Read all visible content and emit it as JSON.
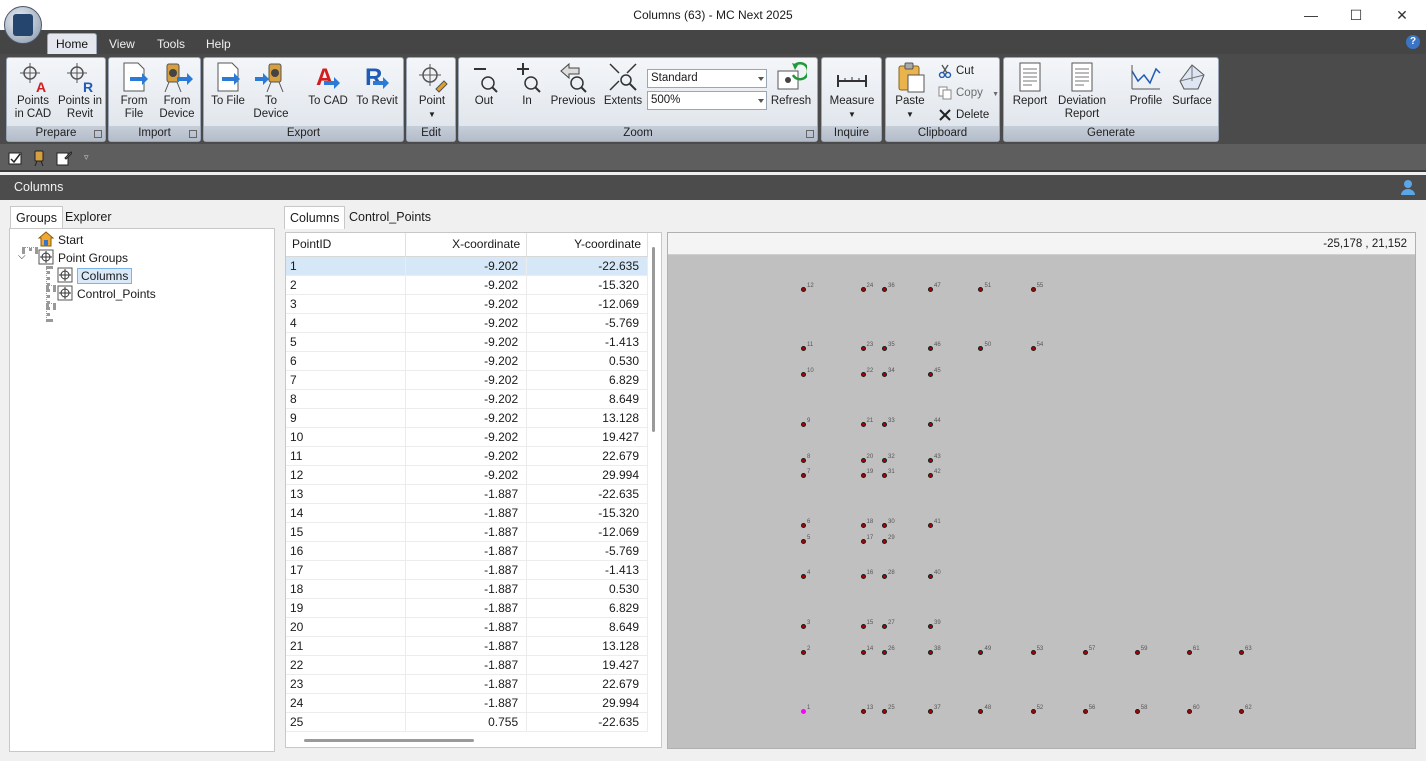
{
  "window": {
    "title": "Columns (63) - MC Next 2025",
    "minimize": "—",
    "maximize": "☐",
    "close": "✕"
  },
  "menu": {
    "tabs": [
      "Home",
      "View",
      "Tools",
      "Help"
    ],
    "active": "Home",
    "help": "?"
  },
  "ribbon": {
    "groups": {
      "prepare": "Prepare",
      "import": "Import",
      "export": "Export",
      "edit": "Edit",
      "zoom": "Zoom",
      "inquire": "Inquire",
      "clipboard": "Clipboard",
      "generate": "Generate"
    },
    "buttons": {
      "points_in_cad": "Points in CAD",
      "points_in_revit": "Points in Revit",
      "from_file": "From File",
      "from_device": "From Device",
      "to_file": "To File",
      "to_device": "To Device",
      "to_cad": "To CAD",
      "to_revit": "To Revit",
      "point": "Point",
      "out": "Out",
      "in": "In",
      "previous": "Previous",
      "extents": "Extents",
      "refresh": "Refresh",
      "measure": "Measure",
      "paste": "Paste",
      "cut": "Cut",
      "copy": "Copy",
      "delete": "Delete",
      "report": "Report",
      "deviation_report": "Deviation Report",
      "profile": "Profile",
      "surface": "Surface"
    },
    "zoom_style": "Standard",
    "zoom_level": "500%"
  },
  "document": {
    "title": "Columns"
  },
  "left_panel": {
    "tabs": [
      "Groups",
      "Explorer"
    ],
    "active": "Groups",
    "tree": {
      "start": "Start",
      "point_groups": "Point Groups",
      "columns": "Columns",
      "control_points": "Control_Points"
    }
  },
  "right_panel": {
    "tabs": [
      "Columns",
      "Control_Points"
    ],
    "active": "Columns",
    "table": {
      "headers": [
        "PointID",
        "X-coordinate",
        "Y-coordinate"
      ],
      "rows": [
        [
          "1",
          "-9.202",
          "-22.635"
        ],
        [
          "2",
          "-9.202",
          "-15.320"
        ],
        [
          "3",
          "-9.202",
          "-12.069"
        ],
        [
          "4",
          "-9.202",
          "-5.769"
        ],
        [
          "5",
          "-9.202",
          "-1.413"
        ],
        [
          "6",
          "-9.202",
          "0.530"
        ],
        [
          "7",
          "-9.202",
          "6.829"
        ],
        [
          "8",
          "-9.202",
          "8.649"
        ],
        [
          "9",
          "-9.202",
          "13.128"
        ],
        [
          "10",
          "-9.202",
          "19.427"
        ],
        [
          "11",
          "-9.202",
          "22.679"
        ],
        [
          "12",
          "-9.202",
          "29.994"
        ],
        [
          "13",
          "-1.887",
          "-22.635"
        ],
        [
          "14",
          "-1.887",
          "-15.320"
        ],
        [
          "15",
          "-1.887",
          "-12.069"
        ],
        [
          "16",
          "-1.887",
          "-5.769"
        ],
        [
          "17",
          "-1.887",
          "-1.413"
        ],
        [
          "18",
          "-1.887",
          "0.530"
        ],
        [
          "19",
          "-1.887",
          "6.829"
        ],
        [
          "20",
          "-1.887",
          "8.649"
        ],
        [
          "21",
          "-1.887",
          "13.128"
        ],
        [
          "22",
          "-1.887",
          "19.427"
        ],
        [
          "23",
          "-1.887",
          "22.679"
        ],
        [
          "24",
          "-1.887",
          "29.994"
        ],
        [
          "25",
          "0.755",
          "-22.635"
        ]
      ],
      "selected_row": 0
    },
    "plot": {
      "cursor_coord": "-25,178 , 21,152",
      "points": [
        {
          "id": "12",
          "x": -9.202,
          "y": 29.994
        },
        {
          "id": "11",
          "x": -9.202,
          "y": 22.679
        },
        {
          "id": "10",
          "x": -9.202,
          "y": 19.427
        },
        {
          "id": "9",
          "x": -9.202,
          "y": 13.128
        },
        {
          "id": "8",
          "x": -9.202,
          "y": 8.649
        },
        {
          "id": "7",
          "x": -9.202,
          "y": 6.829
        },
        {
          "id": "6",
          "x": -9.202,
          "y": 0.53
        },
        {
          "id": "5",
          "x": -9.202,
          "y": -1.413
        },
        {
          "id": "4",
          "x": -9.202,
          "y": -5.769
        },
        {
          "id": "3",
          "x": -9.202,
          "y": -12.069
        },
        {
          "id": "2",
          "x": -9.202,
          "y": -15.32
        },
        {
          "id": "1",
          "x": -9.202,
          "y": -22.635,
          "highlight": true
        },
        {
          "id": "24",
          "x": -1.887,
          "y": 29.994
        },
        {
          "id": "23",
          "x": -1.887,
          "y": 22.679
        },
        {
          "id": "22",
          "x": -1.887,
          "y": 19.427
        },
        {
          "id": "21",
          "x": -1.887,
          "y": 13.128
        },
        {
          "id": "20",
          "x": -1.887,
          "y": 8.649
        },
        {
          "id": "19",
          "x": -1.887,
          "y": 6.829
        },
        {
          "id": "18",
          "x": -1.887,
          "y": 0.53
        },
        {
          "id": "17",
          "x": -1.887,
          "y": -1.413
        },
        {
          "id": "16",
          "x": -1.887,
          "y": -5.769
        },
        {
          "id": "15",
          "x": -1.887,
          "y": -12.069
        },
        {
          "id": "14",
          "x": -1.887,
          "y": -15.32
        },
        {
          "id": "13",
          "x": -1.887,
          "y": -22.635
        },
        {
          "id": "36",
          "x": 0.755,
          "y": 29.994
        },
        {
          "id": "35",
          "x": 0.755,
          "y": 22.679
        },
        {
          "id": "34",
          "x": 0.755,
          "y": 19.427
        },
        {
          "id": "33",
          "x": 0.755,
          "y": 13.128
        },
        {
          "id": "32",
          "x": 0.755,
          "y": 8.649
        },
        {
          "id": "31",
          "x": 0.755,
          "y": 6.829
        },
        {
          "id": "30",
          "x": 0.755,
          "y": 0.53
        },
        {
          "id": "29",
          "x": 0.755,
          "y": -1.413
        },
        {
          "id": "28",
          "x": 0.755,
          "y": -5.769
        },
        {
          "id": "27",
          "x": 0.755,
          "y": -12.069
        },
        {
          "id": "26",
          "x": 0.755,
          "y": -15.32
        },
        {
          "id": "25",
          "x": 0.755,
          "y": -22.635
        },
        {
          "id": "47",
          "x": 6.4,
          "y": 29.994
        },
        {
          "id": "46",
          "x": 6.4,
          "y": 22.679
        },
        {
          "id": "45",
          "x": 6.4,
          "y": 19.427
        },
        {
          "id": "44",
          "x": 6.4,
          "y": 13.128
        },
        {
          "id": "43",
          "x": 6.4,
          "y": 8.649
        },
        {
          "id": "42",
          "x": 6.4,
          "y": 6.829
        },
        {
          "id": "41",
          "x": 6.4,
          "y": 0.53
        },
        {
          "id": "40",
          "x": 6.4,
          "y": -5.769
        },
        {
          "id": "39",
          "x": 6.4,
          "y": -12.069
        },
        {
          "id": "38",
          "x": 6.4,
          "y": -15.32
        },
        {
          "id": "37",
          "x": 6.4,
          "y": -22.635
        },
        {
          "id": "51",
          "x": 12.6,
          "y": 29.994
        },
        {
          "id": "50",
          "x": 12.6,
          "y": 22.679
        },
        {
          "id": "49",
          "x": 12.6,
          "y": -15.32
        },
        {
          "id": "48",
          "x": 12.6,
          "y": -22.635
        },
        {
          "id": "55",
          "x": 19.0,
          "y": 29.994
        },
        {
          "id": "54",
          "x": 19.0,
          "y": 22.679
        },
        {
          "id": "53",
          "x": 19.0,
          "y": -15.32
        },
        {
          "id": "52",
          "x": 19.0,
          "y": -22.635
        },
        {
          "id": "57",
          "x": 25.4,
          "y": -15.32
        },
        {
          "id": "56",
          "x": 25.4,
          "y": -22.635
        },
        {
          "id": "59",
          "x": 31.8,
          "y": -15.32
        },
        {
          "id": "58",
          "x": 31.8,
          "y": -22.635
        },
        {
          "id": "61",
          "x": 38.2,
          "y": -15.32
        },
        {
          "id": "60",
          "x": 38.2,
          "y": -22.635
        },
        {
          "id": "63",
          "x": 44.6,
          "y": -15.32
        },
        {
          "id": "62",
          "x": 44.6,
          "y": -22.635
        }
      ]
    }
  }
}
